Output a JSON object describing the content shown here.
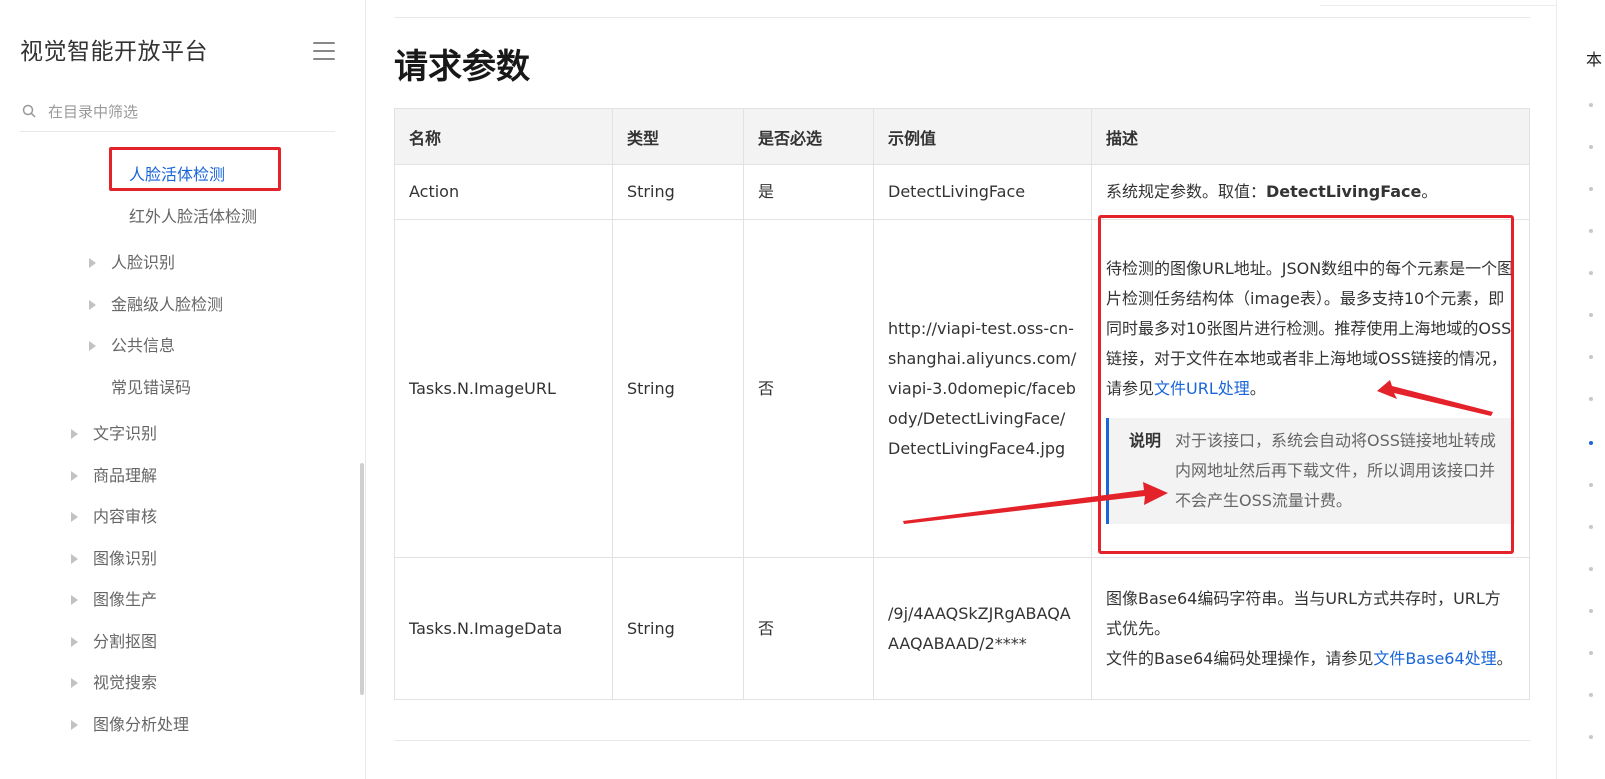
{
  "sidebar": {
    "title": "视觉智能开放平台",
    "search_placeholder": "在目录中筛选",
    "items": [
      {
        "label": "人脸活体检测"
      },
      {
        "label": "红外人脸活体检测"
      },
      {
        "label": "人脸识别"
      },
      {
        "label": "金融级人脸检测"
      },
      {
        "label": "公共信息"
      },
      {
        "label": "常见错误码"
      },
      {
        "label": "文字识别"
      },
      {
        "label": "商品理解"
      },
      {
        "label": "内容审核"
      },
      {
        "label": "图像识别"
      },
      {
        "label": "图像生产"
      },
      {
        "label": "分割抠图"
      },
      {
        "label": "视觉搜索"
      },
      {
        "label": "图像分析处理"
      }
    ]
  },
  "main": {
    "heading": "请求参数",
    "table": {
      "headers": [
        "名称",
        "类型",
        "是否必选",
        "示例值",
        "描述"
      ],
      "rows": [
        {
          "name": "Action",
          "type": "String",
          "required": "是",
          "example": "DetectLivingFace",
          "desc_prefix": "系统规定参数。取值：",
          "desc_bold": "DetectLivingFace",
          "desc_suffix": "。"
        },
        {
          "name": "Tasks.N.ImageURL",
          "type": "String",
          "required": "否",
          "example": "http://viapi-test.oss-cn-shanghai.aliyuncs.com/viapi-3.0domepic/facebody/DetectLivingFace/DetectLivingFace4.jpg",
          "desc_text": "待检测的图像URL地址。JSON数组中的每个元素是一个图片检测任务结构体（image表）。最多支持10个元素，即同时最多对10张图片进行检测。推荐使用上海地域的OSS链接，对于文件在本地或者非上海地域OSS链接的情况，请参见",
          "desc_link": "文件URL处理",
          "desc_suffix": "。",
          "note_label": "说明",
          "note_text": "对于该接口，系统会自动将OSS链接地址转成内网地址然后再下载文件，所以调用该接口并不会产生OSS流量计费。"
        },
        {
          "name": "Tasks.N.ImageData",
          "type": "String",
          "required": "否",
          "example": "/9j/4AAQSkZJRgABAQAAAQABAAD/2****",
          "desc_line1": "图像Base64编码字符串。当与URL方式共存时，URL方式优先。",
          "desc_line2": "文件的Base64编码处理操作，请参见",
          "desc_link": "文件Base64处理",
          "desc_suffix": "。"
        }
      ]
    }
  },
  "rail": {
    "title": "本"
  },
  "colors": {
    "accent": "#1a66d9",
    "annotation": "#e3222a"
  }
}
